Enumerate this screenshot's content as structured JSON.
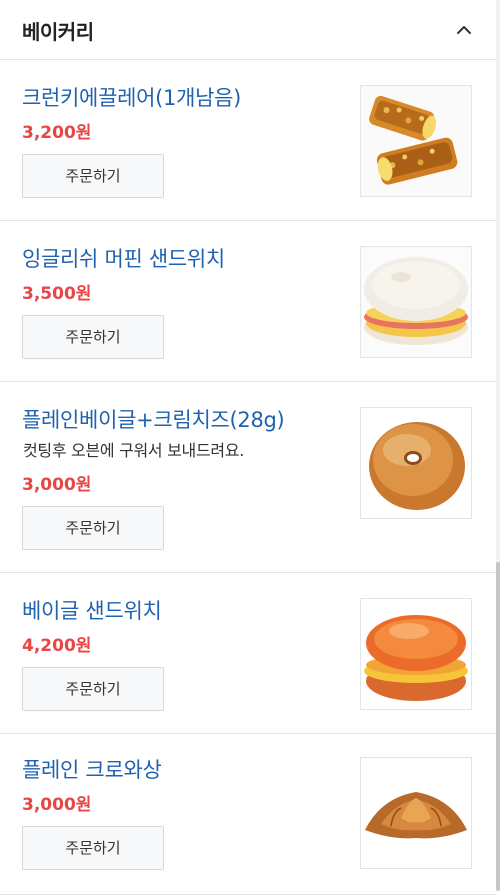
{
  "section": {
    "title": "베이커리",
    "collapse_icon": "chevron-up-icon"
  },
  "items": [
    {
      "name": "크런키에끌레어(1개남음)",
      "description": "",
      "price": "3,200원",
      "order_label": "주문하기",
      "image": "eclair-pastry"
    },
    {
      "name": "잉글리쉬 머핀 샌드위치",
      "description": "",
      "price": "3,500원",
      "order_label": "주문하기",
      "image": "muffin-sandwich"
    },
    {
      "name": "플레인베이글+크림치즈(28g)",
      "description": "컷팅후 오븐에 구워서 보내드려요.",
      "price": "3,000원",
      "order_label": "주문하기",
      "image": "plain-bagel"
    },
    {
      "name": "베이글 샌드위치",
      "description": "",
      "price": "4,200원",
      "order_label": "주문하기",
      "image": "bagel-sandwich"
    },
    {
      "name": "플레인 크로와상",
      "description": "",
      "price": "3,000원",
      "order_label": "주문하기",
      "image": "croissant"
    }
  ],
  "colors": {
    "name": "#1f63b0",
    "price": "#e84545",
    "divider": "#e6e6e6"
  }
}
